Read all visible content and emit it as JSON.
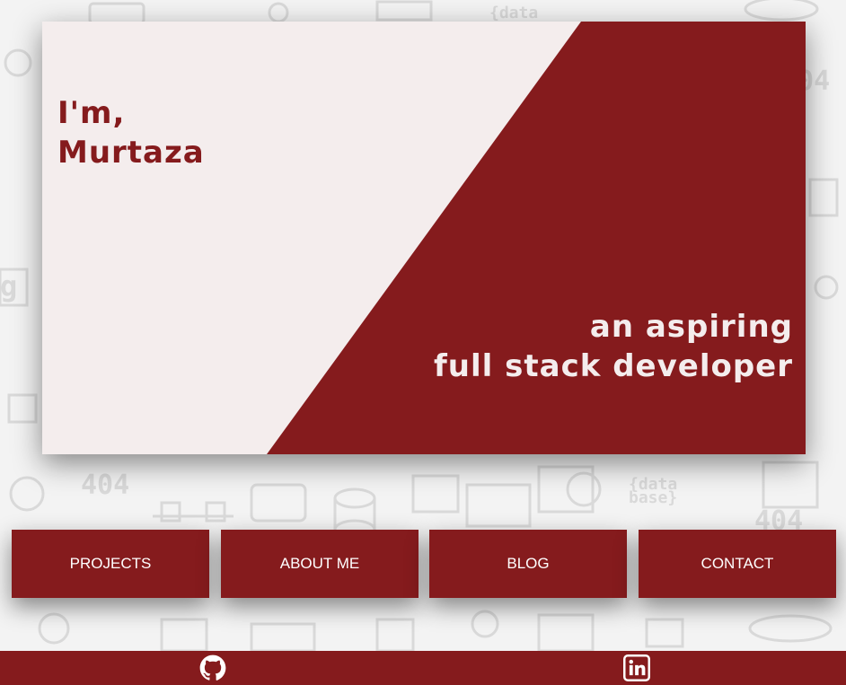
{
  "hero": {
    "greeting_line1": "I'm,",
    "greeting_line2": "Murtaza",
    "tagline_line1": "an aspiring",
    "tagline_line2": "full stack developer"
  },
  "nav": {
    "projects": "PROJECTS",
    "about": "ABOUT ME",
    "blog": "BLOG",
    "contact": "CONTACT"
  },
  "footer": {
    "icons": [
      "github-icon",
      "linkedin-icon"
    ]
  },
  "colors": {
    "brand": "#851b1d",
    "light": "#f4eded",
    "background": "#f3f3f3"
  }
}
